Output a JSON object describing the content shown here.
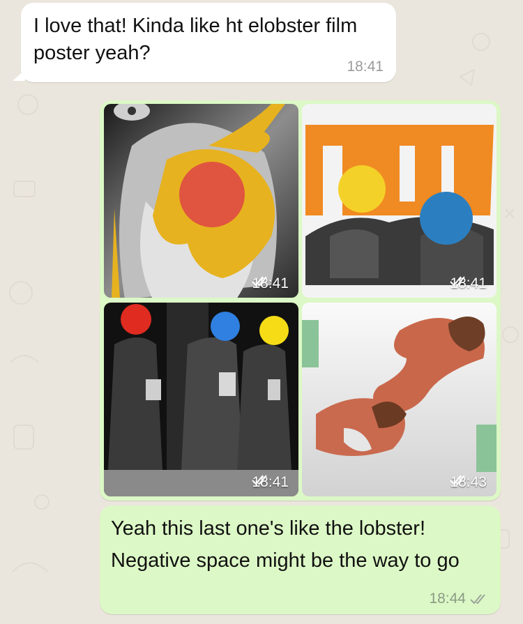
{
  "incoming_message": {
    "text": "I love that! Kinda like ht elobster film poster yeah?",
    "time": "18:41"
  },
  "album": {
    "photos": [
      {
        "label": "collage-old-man",
        "time": "18:41",
        "status_icon": "double-check-icon"
      },
      {
        "label": "collage-two-men-orange",
        "time": "18:41",
        "status_icon": "double-check-icon"
      },
      {
        "label": "collage-three-men-dots",
        "time": "18:41",
        "status_icon": "double-check-icon"
      },
      {
        "label": "collage-figures-negative-space",
        "time": "18:43",
        "status_icon": "double-check-icon"
      }
    ]
  },
  "outgoing_message": {
    "text": "Yeah this last one's like the lobster! Negative space might be the way to go",
    "time": "18:44",
    "status_icon": "double-check-icon"
  },
  "colors": {
    "chat_bg": "#ebe6dd",
    "incoming_bubble": "#ffffff",
    "outgoing_bubble": "#dcf8c6",
    "collage_yellow": "#e7b21f",
    "collage_red": "#e0553f",
    "collage_orange": "#f08a23",
    "collage_blue": "#2b7fc0"
  }
}
